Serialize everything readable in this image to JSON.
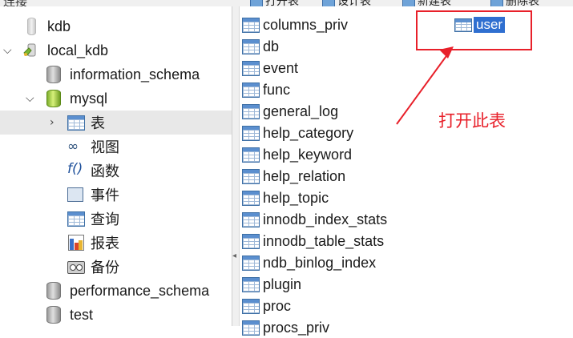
{
  "toolbar": {
    "connection_label": "连接",
    "buttons": [
      {
        "label": "打开表",
        "icon": "open-table-icon"
      },
      {
        "label": "设计表",
        "icon": "design-table-icon"
      },
      {
        "label": "新建表",
        "icon": "new-table-icon"
      },
      {
        "label": "删除表",
        "icon": "delete-table-icon"
      }
    ]
  },
  "tree": {
    "items": [
      {
        "label": "kdb",
        "icon": "connection-icon",
        "expanded": false
      },
      {
        "label": "local_kdb",
        "icon": "connection-icon",
        "expanded": true
      },
      {
        "label": "information_schema",
        "icon": "database-icon"
      },
      {
        "label": "mysql",
        "icon": "database-icon",
        "expanded": true
      },
      {
        "label": "表",
        "icon": "table-icon",
        "selected": true
      },
      {
        "label": "视图",
        "icon": "view-icon"
      },
      {
        "label": "函数",
        "icon": "function-icon"
      },
      {
        "label": "事件",
        "icon": "event-icon"
      },
      {
        "label": "查询",
        "icon": "query-icon"
      },
      {
        "label": "报表",
        "icon": "report-icon"
      },
      {
        "label": "备份",
        "icon": "backup-icon"
      },
      {
        "label": "performance_schema",
        "icon": "database-icon"
      },
      {
        "label": "test",
        "icon": "database-icon"
      }
    ]
  },
  "tables": {
    "items": [
      "columns_priv",
      "db",
      "event",
      "func",
      "general_log",
      "help_category",
      "help_keyword",
      "help_relation",
      "help_topic",
      "innodb_index_stats",
      "innodb_table_stats",
      "ndb_binlog_index",
      "plugin",
      "proc",
      "procs_priv"
    ],
    "selected": "user"
  },
  "annotation": {
    "text": "打开此表",
    "color": "#e8202a"
  },
  "colors": {
    "selection_blue": "#2f6fd0",
    "tree_selected_bg": "#e8e8e8"
  }
}
